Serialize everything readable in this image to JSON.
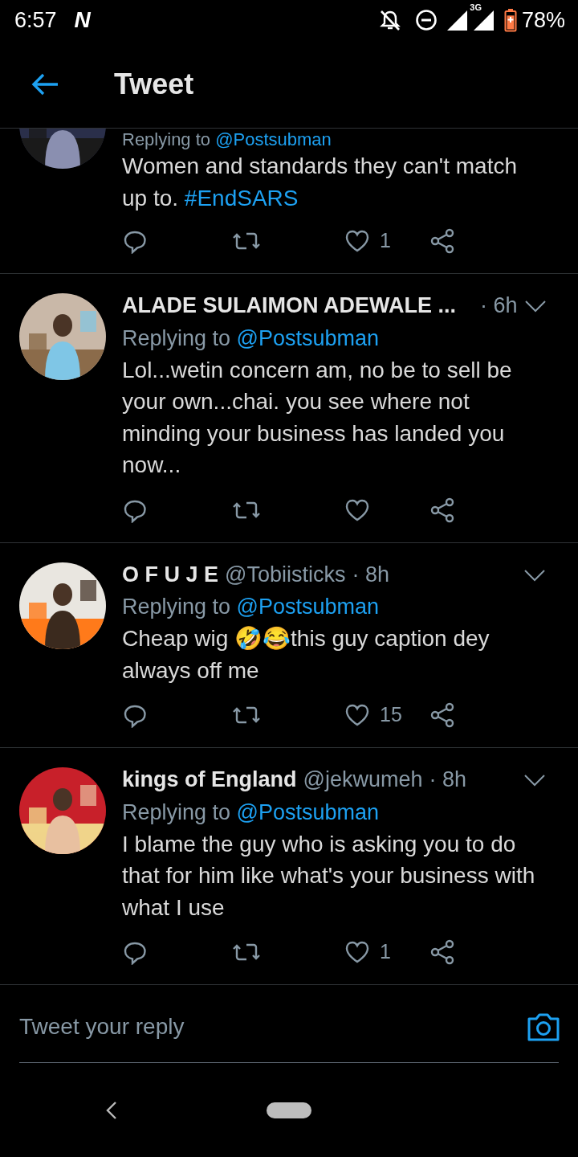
{
  "status_bar": {
    "time": "6:57",
    "app_badge": "N",
    "network": "3G",
    "battery": "78%"
  },
  "header": {
    "title": "Tweet"
  },
  "tweets": [
    {
      "replying_label": "Replying to",
      "replying_to": "@Postsubman",
      "body": "Women and standards they can't match up to. **#EndSARS**",
      "likes": "1"
    },
    {
      "name": "ALADE SULAIMON ADEWALE ...",
      "time": "· 6h",
      "replying_label": "Replying to",
      "replying_to": "@Postsubman",
      "body": "Lol...wetin concern am, no be to sell be your own...chai. you see where not minding your business has landed you now..."
    },
    {
      "name": "O F U J E",
      "handle": "@Tobiisticks",
      "time": "· 8h",
      "replying_label": "Replying to",
      "replying_to": "@Postsubman",
      "body": "Cheap wig 🤣😂this guy caption dey always off me",
      "likes": "15"
    },
    {
      "name": "kings of England",
      "handle": "@jekwumeh",
      "time": "· 8h",
      "replying_label": "Replying to",
      "replying_to": "@Postsubman",
      "body": "I blame the guy who is asking you to do that for him like what's your business with what I use",
      "likes": "1"
    }
  ],
  "reply_bar": {
    "placeholder": "Tweet your reply"
  }
}
